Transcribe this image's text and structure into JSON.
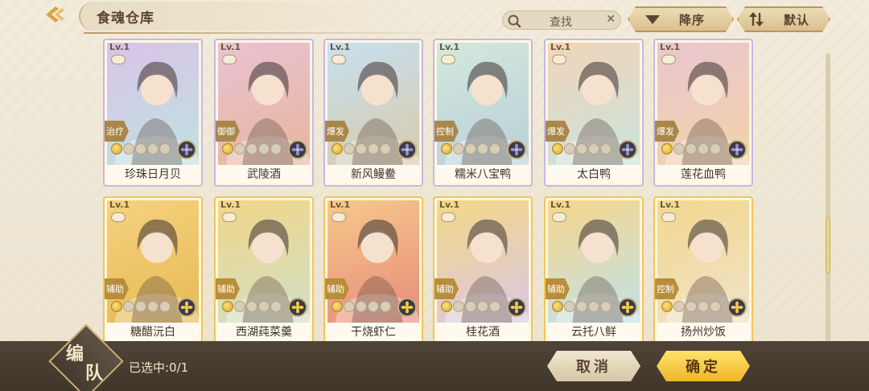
{
  "header": {
    "title": "食魂仓库",
    "search_placeholder": "查找",
    "sort_order_label": "降序",
    "sort_mode_label": "默认"
  },
  "cards": [
    {
      "level": "Lv.1",
      "role": "治疗",
      "name": "珍珠日月贝",
      "stars": 1,
      "bg": "#d9c3e8",
      "bg2": "#bfe3e0",
      "emblem": "dark"
    },
    {
      "level": "Lv.1",
      "role": "御御",
      "name": "武陵酒",
      "stars": 1,
      "bg": "#e9c2d4",
      "bg2": "#e8b69a",
      "emblem": "dark"
    },
    {
      "level": "Lv.1",
      "role": "爆发",
      "name": "新风鳗鲞",
      "stars": 1,
      "bg": "#c7e0f0",
      "bg2": "#d9c9a8",
      "emblem": "dark"
    },
    {
      "level": "Lv.1",
      "role": "控制",
      "name": "糯米八宝鸭",
      "stars": 1,
      "bg": "#d3e8dc",
      "bg2": "#b8cfd9",
      "emblem": "dark"
    },
    {
      "level": "Lv.1",
      "role": "爆发",
      "name": "太白鸭",
      "stars": 1,
      "bg": "#f1d4b8",
      "bg2": "#c9e4df",
      "emblem": "dark"
    },
    {
      "level": "Lv.1",
      "role": "爆发",
      "name": "莲花血鸭",
      "stars": 1,
      "bg": "#e8c6cf",
      "bg2": "#f3d3a9",
      "emblem": "dark"
    },
    {
      "level": "Lv.1",
      "role": "辅助",
      "name": "糖醋沅白",
      "stars": 1,
      "bg": "#f4d27e",
      "bg2": "#e7b954",
      "emblem": "gold"
    },
    {
      "level": "Lv.1",
      "role": "辅助",
      "name": "西湖莼菜羹",
      "stars": 1,
      "bg": "#f2d687",
      "bg2": "#cfe0c9",
      "emblem": "gold"
    },
    {
      "level": "Lv.1",
      "role": "辅助",
      "name": "干烧虾仁",
      "stars": 1,
      "bg": "#f5c98a",
      "bg2": "#e98a7a",
      "emblem": "gold"
    },
    {
      "level": "Lv.1",
      "role": "辅助",
      "name": "桂花酒",
      "stars": 1,
      "bg": "#f4d784",
      "bg2": "#d9c7ea",
      "emblem": "gold"
    },
    {
      "level": "Lv.1",
      "role": "辅助",
      "name": "云托八鲜",
      "stars": 1,
      "bg": "#f6d68a",
      "bg2": "#bfe2ec",
      "emblem": "gold"
    },
    {
      "level": "Lv.1",
      "role": "控制",
      "name": "扬州炒饭",
      "stars": 1,
      "bg": "#f3d88f",
      "bg2": "#efe2c9",
      "emblem": "gold"
    }
  ],
  "footer": {
    "team_label_1": "编",
    "team_label_2": "队",
    "selected_text": "已选中:0/1",
    "cancel_label": "取消",
    "confirm_label": "确定"
  },
  "colors": {
    "accent_gold": "#f0b52a",
    "footer_bg": "#463b2f",
    "text_dark": "#5a4630"
  },
  "icons": {
    "back": "chevron-left-icon",
    "search": "search-icon",
    "clear": "close-icon",
    "sort_desc": "chevron-down-icon",
    "sort_default": "sort-icon",
    "lock": "lock-icon",
    "emblem": "flower-emblem-icon"
  }
}
